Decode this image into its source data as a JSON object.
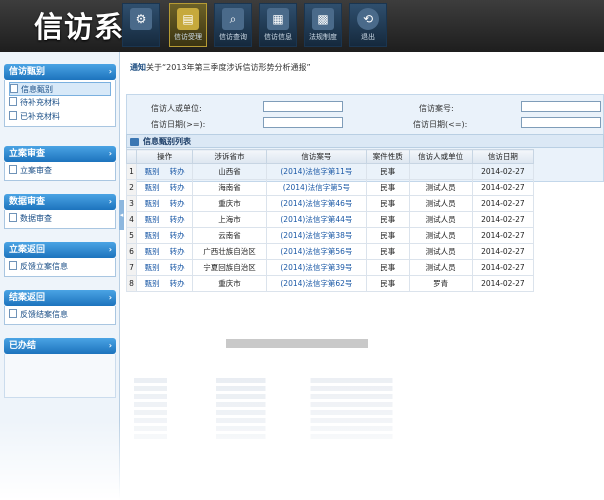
{
  "app": {
    "title": "信访系统"
  },
  "toolbar": {
    "buttons": [
      {
        "label": "",
        "icon": "gear-icon"
      },
      {
        "label": "信访受理",
        "icon": "inbox-icon"
      },
      {
        "label": "信访查询",
        "icon": "magnifier-icon"
      },
      {
        "label": "信访信息",
        "icon": "book-icon"
      },
      {
        "label": "法规制度",
        "icon": "calculator-icon"
      },
      {
        "label": "退出",
        "icon": "exit-icon"
      }
    ]
  },
  "sidebar": {
    "groups": [
      {
        "title": "信访甄别",
        "items": [
          "信息甄别",
          "待补充材料",
          "已补充材料"
        ]
      },
      {
        "title": "立案审查",
        "items": [
          "立案审查"
        ]
      },
      {
        "title": "数据审查",
        "items": [
          "数据审查"
        ]
      },
      {
        "title": "立案返回",
        "items": [
          "反馈立案信息"
        ]
      },
      {
        "title": "结案返回",
        "items": [
          "反馈结案信息"
        ]
      },
      {
        "title": "已办结",
        "items": []
      }
    ],
    "selected": "信息甄别"
  },
  "notice": {
    "tag": "通知",
    "text": "关于“2013年第三季度涉诉信访形势分析通报”"
  },
  "search": {
    "person_label": "信访人或单位:",
    "case_label": "信访案号:",
    "date_from_label": "信访日期(>=):",
    "date_to_label": "信访日期(<=):"
  },
  "list": {
    "title": "信息甄别列表",
    "columns": [
      "操作",
      "涉诉省市",
      "信访案号",
      "案件性质",
      "信访人或单位",
      "信访日期"
    ],
    "action_screen": "甄别",
    "action_forward": "转办",
    "rows": [
      {
        "no": "1",
        "province": "山西省",
        "case": "(2014)法信字第11号",
        "type": "民事",
        "person": "",
        "date": "2014-02-27"
      },
      {
        "no": "2",
        "province": "海南省",
        "case": "(2014)法信字第5号",
        "type": "民事",
        "person": "测试人员",
        "date": "2014-02-27"
      },
      {
        "no": "3",
        "province": "重庆市",
        "case": "(2014)法信字第46号",
        "type": "民事",
        "person": "测试人员",
        "date": "2014-02-27"
      },
      {
        "no": "4",
        "province": "上海市",
        "case": "(2014)法信字第44号",
        "type": "民事",
        "person": "测试人员",
        "date": "2014-02-27"
      },
      {
        "no": "5",
        "province": "云南省",
        "case": "(2014)法信字第38号",
        "type": "民事",
        "person": "测试人员",
        "date": "2014-02-27"
      },
      {
        "no": "6",
        "province": "广西壮族自治区",
        "case": "(2014)法信字第56号",
        "type": "民事",
        "person": "测试人员",
        "date": "2014-02-27"
      },
      {
        "no": "7",
        "province": "宁夏回族自治区",
        "case": "(2014)法信字第39号",
        "type": "民事",
        "person": "测试人员",
        "date": "2014-02-27"
      },
      {
        "no": "8",
        "province": "重庆市",
        "case": "(2014)法信字第62号",
        "type": "民事",
        "person": "罗青",
        "date": "2014-02-27"
      }
    ]
  }
}
